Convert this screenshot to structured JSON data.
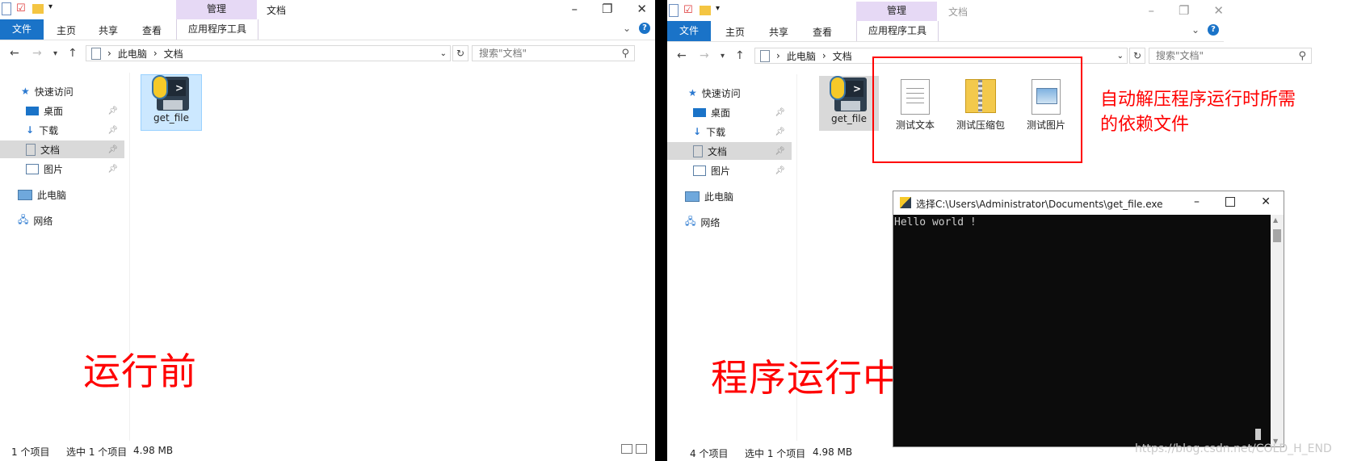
{
  "left_window": {
    "title": "文档",
    "manage_tab": "管理",
    "tabs": {
      "file": "文件",
      "home": "主页",
      "share": "共享",
      "view": "查看",
      "app_tools": "应用程序工具"
    },
    "address": {
      "this_pc": "此电脑",
      "folder": "文档"
    },
    "search_placeholder": "搜索\"文档\"",
    "nav": {
      "quick_access": "快速访问",
      "desktop": "桌面",
      "downloads": "下载",
      "documents": "文档",
      "pictures": "图片",
      "this_pc": "此电脑",
      "network": "网络"
    },
    "files": [
      {
        "name": "get_file"
      }
    ],
    "status": {
      "count": "1 个项目",
      "selected": "选中 1 个项目",
      "size": "4.98 MB"
    },
    "annotation": "运行前"
  },
  "right_window": {
    "title": "文档",
    "manage_tab": "管理",
    "tabs": {
      "file": "文件",
      "home": "主页",
      "share": "共享",
      "view": "查看",
      "app_tools": "应用程序工具"
    },
    "address": {
      "this_pc": "此电脑",
      "folder": "文档"
    },
    "search_placeholder": "搜索\"文档\"",
    "nav": {
      "quick_access": "快速访问",
      "desktop": "桌面",
      "downloads": "下载",
      "documents": "文档",
      "pictures": "图片",
      "this_pc": "此电脑",
      "network": "网络"
    },
    "files": [
      {
        "name": "get_file"
      },
      {
        "name": "测试文本"
      },
      {
        "name": "测试压缩包"
      },
      {
        "name": "测试图片"
      }
    ],
    "status": {
      "count": "4 个项目",
      "selected": "选中 1 个项目",
      "size": "4.98 MB"
    },
    "annotation": "程序运行中",
    "dependency_note_line1": "自动解压程序运行时所需",
    "dependency_note_line2": "的依赖文件"
  },
  "console": {
    "title": "选择C:\\Users\\Administrator\\Documents\\get_file.exe",
    "output": "Hello world !"
  },
  "watermark": "https://blog.csdn.net/COLD_H_END",
  "colors": {
    "accent": "#1a73c8",
    "manage_bg": "#e6d9f5",
    "annotation_red": "#ff0000"
  }
}
